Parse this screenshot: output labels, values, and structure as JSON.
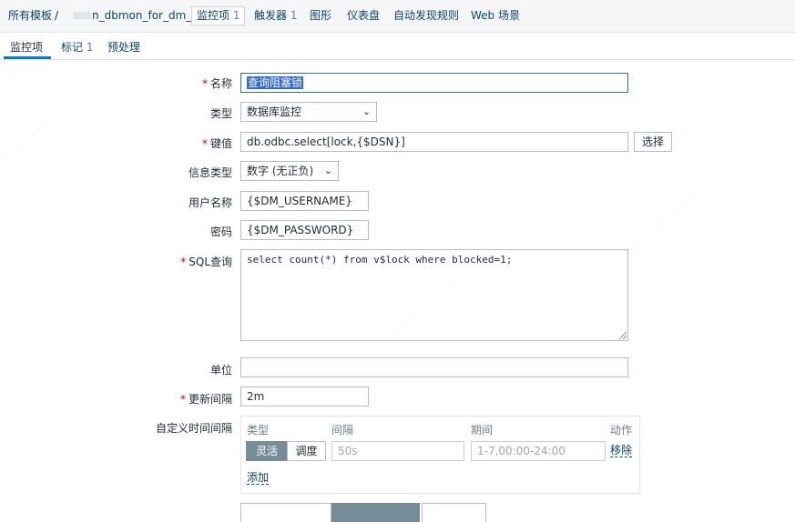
{
  "breadcrumb": {
    "all_templates": "所有模板",
    "separator": "/",
    "template_name": "n_dbmon_for_dm_bg",
    "items_label": "监控项",
    "items_count": "1",
    "triggers_label": "触发器",
    "triggers_count": "1",
    "graphs": "图形",
    "dashboards": "仪表盘",
    "discovery": "自动发现规则",
    "web": "Web 场景"
  },
  "subtabs": {
    "item": "监控项",
    "tags_label": "标记",
    "tags_count": "1",
    "preprocessing": "预处理"
  },
  "form": {
    "name_label": "名称",
    "name_value": "查询阻塞锁",
    "type_label": "类型",
    "type_value": "数据库监控",
    "key_label": "键值",
    "key_value": "db.odbc.select[lock,{$DSN}]",
    "select_button": "选择",
    "info_type_label": "信息类型",
    "info_type_value": "数字 (无正负)",
    "username_label": "用户名称",
    "username_value": "{$DM_USERNAME}",
    "password_label": "密码",
    "password_value": "{$DM_PASSWORD}",
    "sql_label": "SQL查询",
    "sql_value": "select count(*) from v$lock where blocked=1;",
    "units_label": "单位",
    "units_value": "",
    "interval_label": "更新间隔",
    "interval_value": "2m",
    "custom_intervals_label": "自定义时间间隔",
    "ci_type": "类型",
    "ci_interval": "间隔",
    "ci_period": "期间",
    "ci_action": "动作",
    "ci_flexible": "灵活",
    "ci_scheduling": "调度",
    "ci_interval_placeholder": "50s",
    "ci_period_placeholder": "1-7,00:00-24:00",
    "ci_remove": "移除",
    "ci_add": "添加"
  },
  "colors": {
    "link": "#0a466a",
    "required": "#d40000",
    "segment_active": "#768d99",
    "tab_underline": "#0a7bc2"
  }
}
